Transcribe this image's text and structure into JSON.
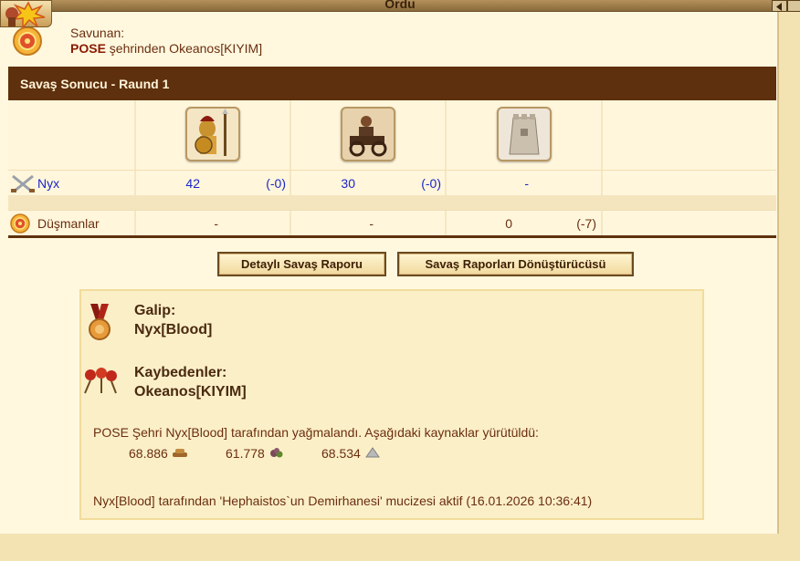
{
  "window": {
    "title": "Ordu"
  },
  "defender": {
    "label": "Savunan:",
    "city": "POSE",
    "line_rest": " şehrinden Okeanos[KIYIM]"
  },
  "result": {
    "header": "Savaş Sonucu - Raund 1",
    "attacker": {
      "name": "Nyx",
      "cols": [
        {
          "count": "42",
          "loss": "(-0)"
        },
        {
          "count": "30",
          "loss": "(-0)"
        },
        {
          "count": "-",
          "loss": ""
        }
      ]
    },
    "enemy": {
      "name": "Düşmanlar",
      "cols": [
        {
          "count": "-",
          "loss": ""
        },
        {
          "count": "-",
          "loss": ""
        },
        {
          "count": "0",
          "loss": "(-7)"
        }
      ]
    }
  },
  "buttons": {
    "detail": "Detaylı Savaş Raporu",
    "converter": "Savaş Raporları Dönüştürücüsü"
  },
  "report": {
    "winner_label": "Galip:",
    "winner": "Nyx[Blood]",
    "losers_label": "Kaybedenler:",
    "losers": "Okeanos[KIYIM]",
    "plunder_text": "POSE Şehri Nyx[Blood] tarafından yağmalandı. Aşağıdaki kaynaklar yürütüldü:",
    "resources": [
      {
        "amount": "68.886",
        "icon": "wood-icon"
      },
      {
        "amount": "61.778",
        "icon": "stone-icon"
      },
      {
        "amount": "68.534",
        "icon": "silver-icon"
      }
    ],
    "miracle_text": "Nyx[Blood] tarafından 'Hephaistos`un Demirhanesi' mucizesi aktif (16.01.2026 10:36:41)"
  }
}
